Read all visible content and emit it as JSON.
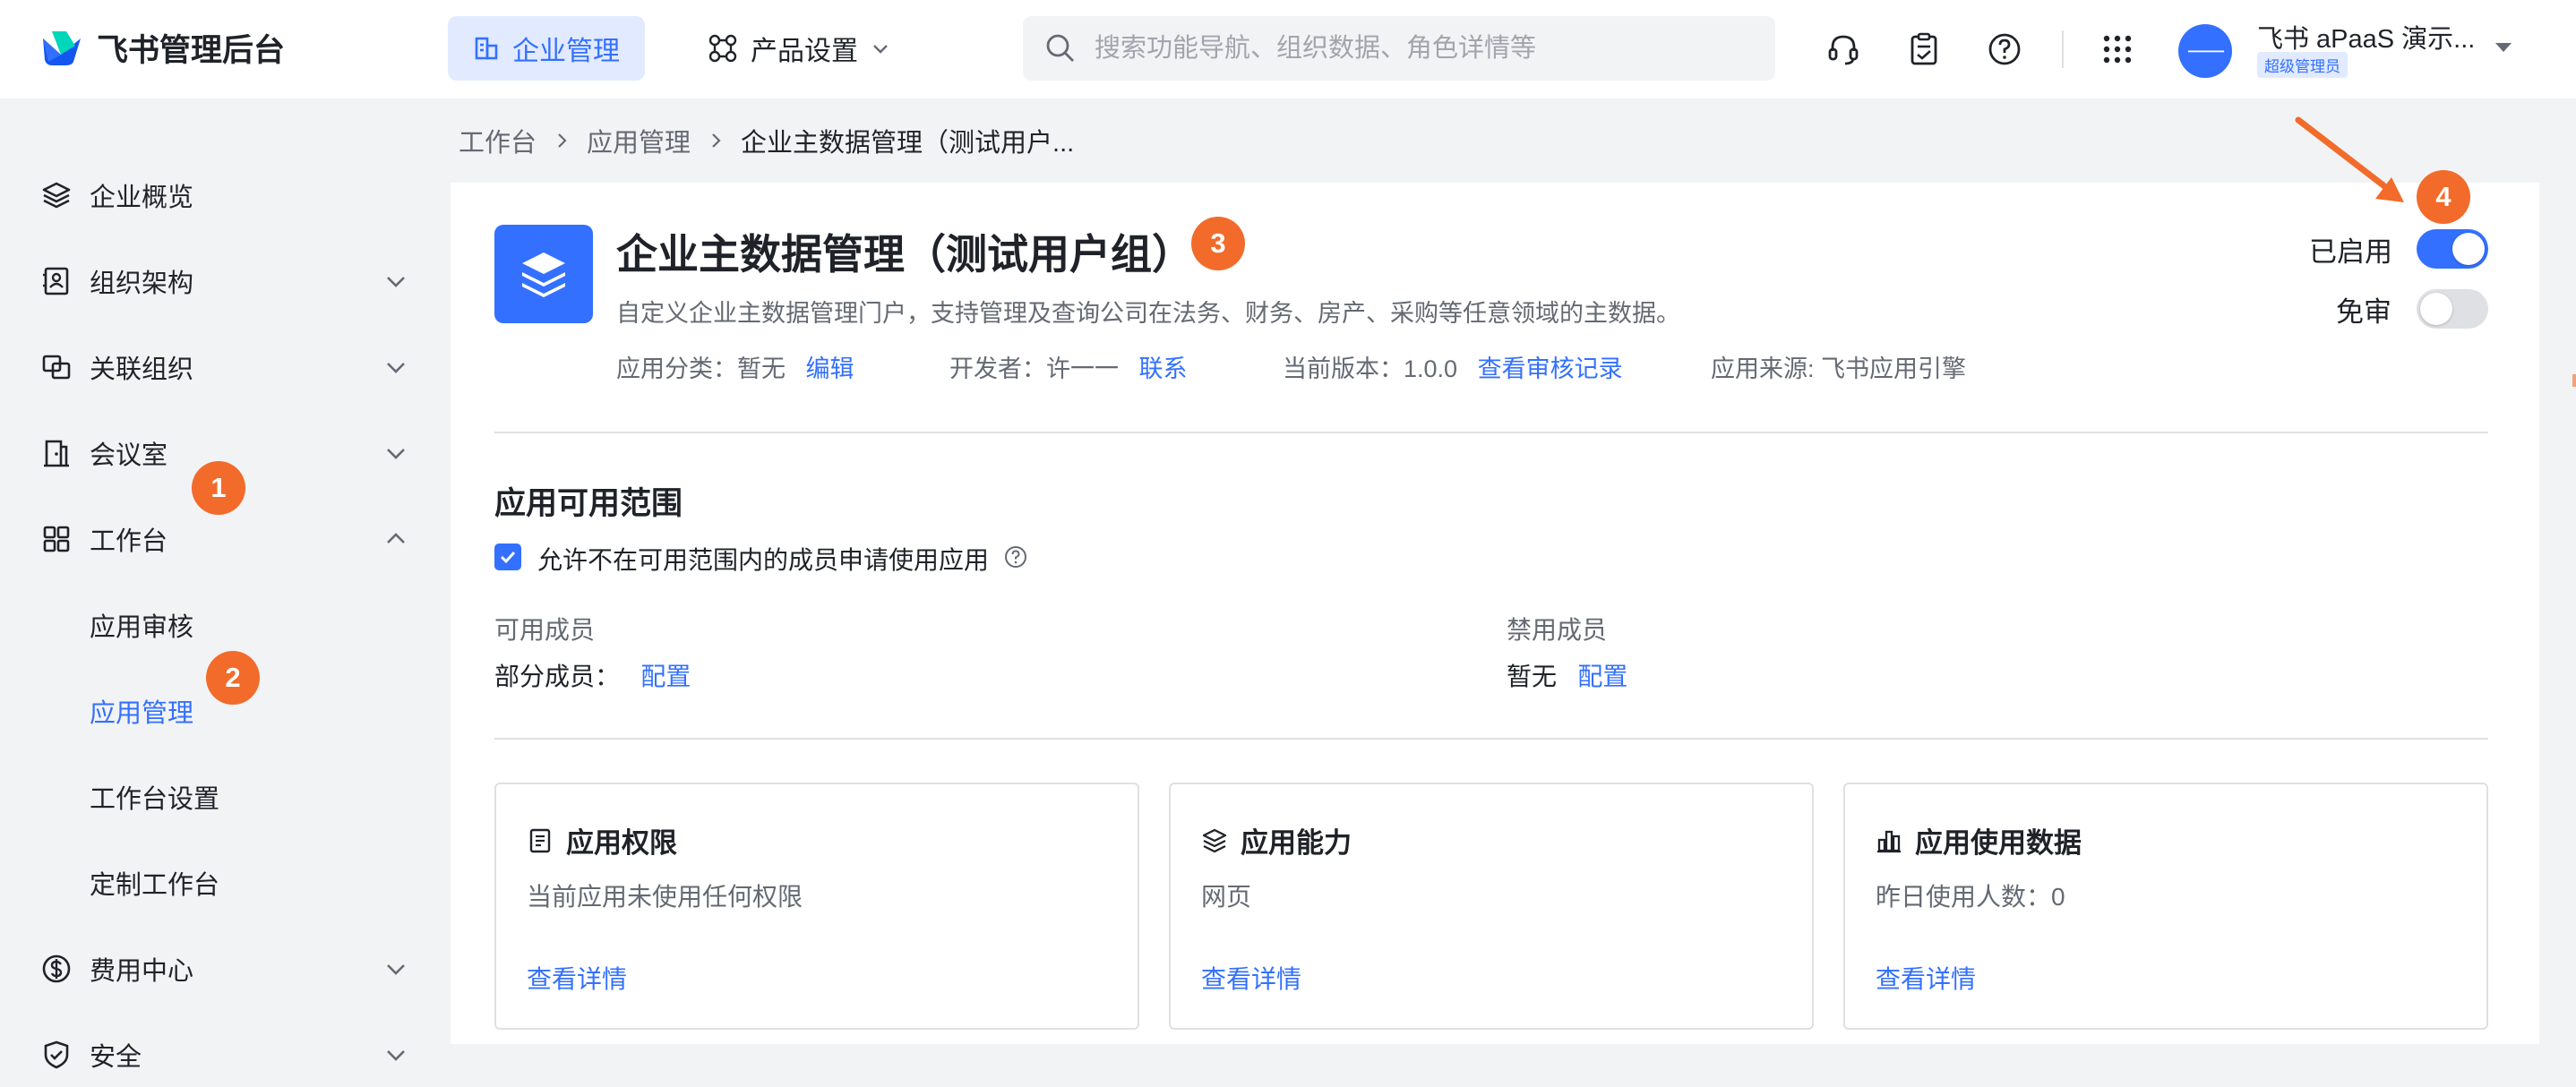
{
  "header": {
    "logo_text": "飞书管理后台",
    "nav_active": "企业管理",
    "nav_product": "产品设置",
    "search_placeholder": "搜索功能导航、组织数据、角色详情等",
    "user_avatar": "一一",
    "user_name": "飞书 aPaaS 演示...",
    "user_role": "超级管理员"
  },
  "sidebar": {
    "items": [
      {
        "label": "企业概览"
      },
      {
        "label": "组织架构"
      },
      {
        "label": "关联组织"
      },
      {
        "label": "会议室"
      },
      {
        "label": "工作台"
      },
      {
        "label": "应用审核"
      },
      {
        "label": "应用管理"
      },
      {
        "label": "工作台设置"
      },
      {
        "label": "定制工作台"
      },
      {
        "label": "费用中心"
      },
      {
        "label": "安全"
      }
    ]
  },
  "badges": {
    "b1": "1",
    "b2": "2",
    "b3": "3",
    "b4": "4"
  },
  "breadcrumb": {
    "items": [
      "工作台",
      "应用管理",
      "企业主数据管理（测试用户..."
    ]
  },
  "app": {
    "title": "企业主数据管理（测试用户组）",
    "description": "自定义企业主数据管理门户，支持管理及查询公司在法务、财务、房产、采购等任意领域的主数据。",
    "category_label": "应用分类：暂无",
    "category_edit": "编辑",
    "developer_label": "开发者：许一一",
    "developer_contact": "联系",
    "version_label": "当前版本：1.0.0",
    "version_link": "查看审核记录",
    "source_label": "应用来源: 飞书应用引擎",
    "enabled_label": "已启用",
    "enabled": true,
    "exempt_label": "免审",
    "exempt": false
  },
  "scope": {
    "title": "应用可用范围",
    "allow_apply_label": "允许不在可用范围内的成员申请使用应用",
    "allow_apply": true,
    "available_label": "可用成员",
    "available_value": "部分成员：",
    "available_link": "配置",
    "banned_label": "禁用成员",
    "banned_value": "暂无",
    "banned_link": "配置"
  },
  "cards": [
    {
      "title": "应用权限",
      "desc": "当前应用未使用任何权限",
      "link": "查看详情",
      "icon": "list-icon"
    },
    {
      "title": "应用能力",
      "desc": "网页",
      "link": "查看详情",
      "icon": "layers-icon"
    },
    {
      "title": "应用使用数据",
      "desc": "昨日使用人数：0",
      "link": "查看详情",
      "icon": "bar-chart-icon"
    }
  ],
  "colors": {
    "accent": "#3370ff",
    "badge": "#f26b2a"
  }
}
